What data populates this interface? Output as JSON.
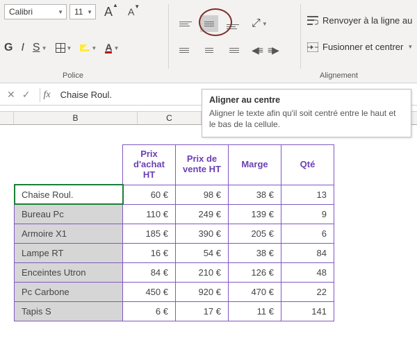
{
  "ribbon": {
    "font_name": "Calibri",
    "font_size": "11",
    "bold": "G",
    "italic": "I",
    "underline": "S",
    "font_color_letter": "A",
    "group_font": "Police",
    "group_align": "Alignement",
    "wrap_text": "Renvoyer à la ligne au",
    "merge_center": "Fusionner et centrer"
  },
  "tooltip": {
    "title": "Aligner au centre",
    "body": "Aligner le texte afin qu'il soit centré entre le haut et le bas de la cellule."
  },
  "formula_bar": {
    "cancel": "✕",
    "confirm": "✓",
    "fx": "fx",
    "value": "Chaise Roul."
  },
  "columns": {
    "B": "B",
    "C": "C"
  },
  "headers": [
    "Prix d'achat HT",
    "Prix de vente HT",
    "Marge",
    "Qté"
  ],
  "rows": [
    {
      "name": "Chaise Roul.",
      "buy": "60 €",
      "sell": "98 €",
      "margin": "38 €",
      "qty": "13",
      "active": true
    },
    {
      "name": "Bureau Pc",
      "buy": "110 €",
      "sell": "249 €",
      "margin": "139 €",
      "qty": "9"
    },
    {
      "name": "Armoire X1",
      "buy": "185 €",
      "sell": "390 €",
      "margin": "205 €",
      "qty": "6"
    },
    {
      "name": "Lampe RT",
      "buy": "16 €",
      "sell": "54 €",
      "margin": "38 €",
      "qty": "84"
    },
    {
      "name": "Enceintes Utron",
      "buy": "84 €",
      "sell": "210 €",
      "margin": "126 €",
      "qty": "48"
    },
    {
      "name": "Pc Carbone",
      "buy": "450 €",
      "sell": "920 €",
      "margin": "470 €",
      "qty": "22"
    },
    {
      "name": "Tapis S",
      "buy": "6 €",
      "sell": "17 €",
      "margin": "11 €",
      "qty": "141"
    }
  ]
}
